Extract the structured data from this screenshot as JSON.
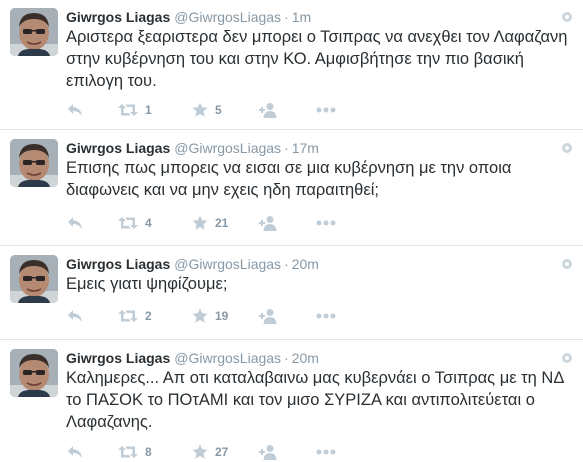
{
  "colors": {
    "icon": "#c1cdd6",
    "text": "#292f33",
    "muted": "#8899a6",
    "divider": "#e1e8ed"
  },
  "icons": {
    "reply": "reply-icon",
    "retweet": "retweet-icon",
    "favorite": "star-icon",
    "follow": "follow-icon",
    "more": "more-dots-icon",
    "gear": "gear-icon"
  },
  "tweets": [
    {
      "fullname": "Giwrgos Liagas",
      "username": "@GiwrgosLiagas",
      "separator": "·",
      "time": "1m",
      "text": "Αριστερα ξεαριστερα δεν μπορει ο Τσιπρας να ανεχθει τον Λαφαζανη στην κυβέρνηση του και στην ΚΟ. Αμφισβήτησε την πιο βασική επιλογη του.",
      "retweets": "1",
      "favorites": "5"
    },
    {
      "fullname": "Giwrgos Liagas",
      "username": "@GiwrgosLiagas",
      "separator": "·",
      "time": "17m",
      "text": "Επισης πως μπορεις να εισαι σε μια κυβέρνηση με την οποια διαφωνεις και να μην εχεις ηδη παραιτηθεί;",
      "retweets": "4",
      "favorites": "21"
    },
    {
      "fullname": "Giwrgos Liagas",
      "username": "@GiwrgosLiagas",
      "separator": "·",
      "time": "20m",
      "text": "Εμεις γιατι ψηφίζουμε;",
      "retweets": "2",
      "favorites": "19"
    },
    {
      "fullname": "Giwrgos Liagas",
      "username": "@GiwrgosLiagas",
      "separator": "·",
      "time": "20m",
      "text": "Καλημερες... Απ οτι καταλαβαινω μας κυβερνάει ο Τσιπρας με τη ΝΔ το ΠΑΣΟΚ το ΠΟτΑΜΙ και τον μισο ΣΥΡΙΖΑ και αντιπολιτεύεται ο Λαφαζανης.",
      "retweets": "8",
      "favorites": "27"
    }
  ]
}
